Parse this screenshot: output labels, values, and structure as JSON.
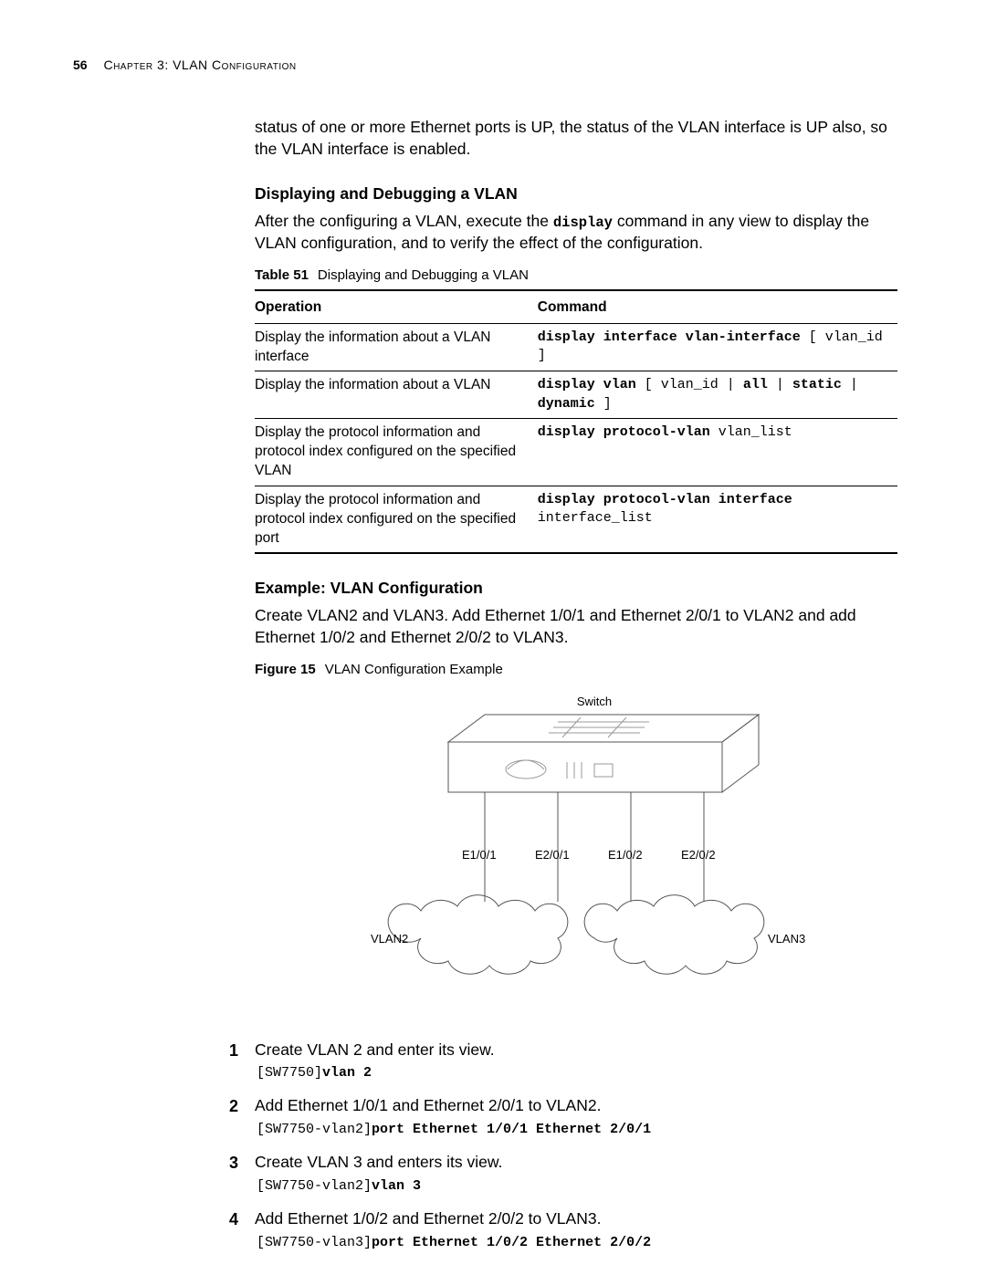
{
  "header": {
    "page_number": "56",
    "chapter": "Chapter 3: VLAN Configuration"
  },
  "intro_paragraph": "status of one or more Ethernet ports is UP, the status of the VLAN interface is UP also, so the VLAN interface is enabled.",
  "section_display": {
    "title": "Displaying and Debugging a VLAN",
    "paragraph_pre": "After the configuring a VLAN, execute the ",
    "paragraph_code": "display",
    "paragraph_post": " command in any view to display the VLAN configuration, and to verify the effect of the configuration.",
    "table_caption_label": "Table 51",
    "table_caption_text": "Displaying and Debugging a VLAN",
    "table": {
      "head_operation": "Operation",
      "head_command": "Command",
      "rows": [
        {
          "operation": "Display the information about a VLAN interface",
          "cmd_parts": [
            {
              "t": "display interface vlan-interface",
              "b": true
            },
            {
              "t": " [ vlan_id ]",
              "b": false
            }
          ]
        },
        {
          "operation": "Display the information about a VLAN",
          "cmd_parts": [
            {
              "t": "display vlan",
              "b": true
            },
            {
              "t": " [ vlan_id | ",
              "b": false
            },
            {
              "t": "all",
              "b": true
            },
            {
              "t": " | ",
              "b": false
            },
            {
              "t": "static",
              "b": true
            },
            {
              "t": " | ",
              "b": false
            },
            {
              "t": "dynamic",
              "b": true
            },
            {
              "t": " ]",
              "b": false
            }
          ]
        },
        {
          "operation": "Display the protocol information and protocol index configured on the specified VLAN",
          "cmd_parts": [
            {
              "t": "display protocol-vlan",
              "b": true
            },
            {
              "t": " vlan_list",
              "b": false
            }
          ]
        },
        {
          "operation": "Display the protocol information and protocol index configured on the specified port",
          "cmd_parts": [
            {
              "t": "display protocol-vlan interface",
              "b": true
            },
            {
              "t": " interface_list",
              "b": false
            }
          ]
        }
      ]
    }
  },
  "section_example": {
    "title": "Example: VLAN Configuration",
    "paragraph": "Create VLAN2 and VLAN3. Add Ethernet 1/0/1 and Ethernet 2/0/1 to VLAN2 and add Ethernet 1/0/2 and Ethernet 2/0/2 to VLAN3.",
    "figure_caption_label": "Figure 15",
    "figure_caption_text": "VLAN Configuration Example",
    "figure_labels": {
      "switch": "Switch",
      "p1": "E1/0/1",
      "p2": "E2/0/1",
      "p3": "E1/0/2",
      "p4": "E2/0/2",
      "vlan2": "VLAN2",
      "vlan3": "VLAN3"
    },
    "steps": [
      {
        "num": "1",
        "text": "Create VLAN 2 and enter its view.",
        "prompt": "[SW7750]",
        "cmd": "vlan 2"
      },
      {
        "num": "2",
        "text": "Add Ethernet 1/0/1 and Ethernet 2/0/1 to VLAN2.",
        "prompt": "[SW7750-vlan2]",
        "cmd": "port Ethernet 1/0/1 Ethernet 2/0/1"
      },
      {
        "num": "3",
        "text": "Create VLAN 3 and enters its view.",
        "prompt": "[SW7750-vlan2]",
        "cmd": "vlan 3"
      },
      {
        "num": "4",
        "text": "Add Ethernet 1/0/2 and Ethernet 2/0/2 to VLAN3.",
        "prompt": "[SW7750-vlan3]",
        "cmd": "port Ethernet 1/0/2 Ethernet 2/0/2"
      }
    ]
  }
}
